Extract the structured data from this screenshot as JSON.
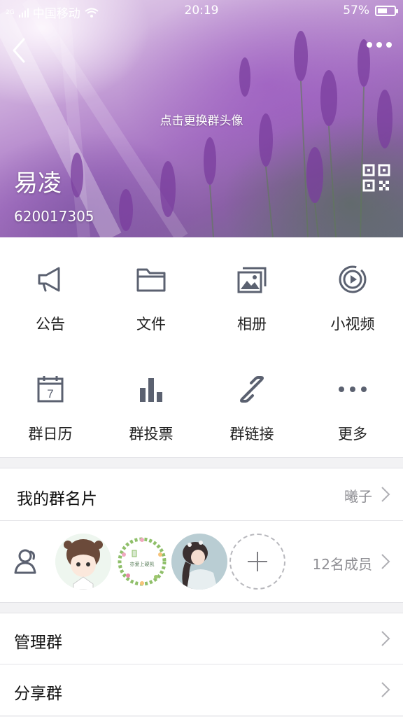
{
  "status_bar": {
    "carrier": "中国移动",
    "network": "2G",
    "time": "20:19",
    "battery": "57%",
    "battery_level": 0.57
  },
  "header": {
    "change_avatar_hint": "点击更换群头像",
    "group_name": "易凌",
    "group_id": "620017305"
  },
  "features": [
    {
      "label": "公告",
      "icon": "megaphone-icon"
    },
    {
      "label": "文件",
      "icon": "folder-icon"
    },
    {
      "label": "相册",
      "icon": "photo-album-icon"
    },
    {
      "label": "小视频",
      "icon": "video-play-icon"
    },
    {
      "label": "群日历",
      "icon": "calendar-icon"
    },
    {
      "label": "群投票",
      "icon": "bar-chart-icon"
    },
    {
      "label": "群链接",
      "icon": "link-icon"
    },
    {
      "label": "更多",
      "icon": "more-dots-icon"
    }
  ],
  "calendar_day": "7",
  "my_card": {
    "title": "我的群名片",
    "value": "曦子"
  },
  "members": {
    "count_label": "12名成员",
    "avatar_text": "亦爱上硬凯"
  },
  "menu": [
    {
      "label": "管理群"
    },
    {
      "label": "分享群"
    }
  ],
  "colors": {
    "icon_gray": "#5b6170",
    "text": "#222222",
    "secondary": "#8e8e93",
    "background": "#f2f2f4"
  }
}
